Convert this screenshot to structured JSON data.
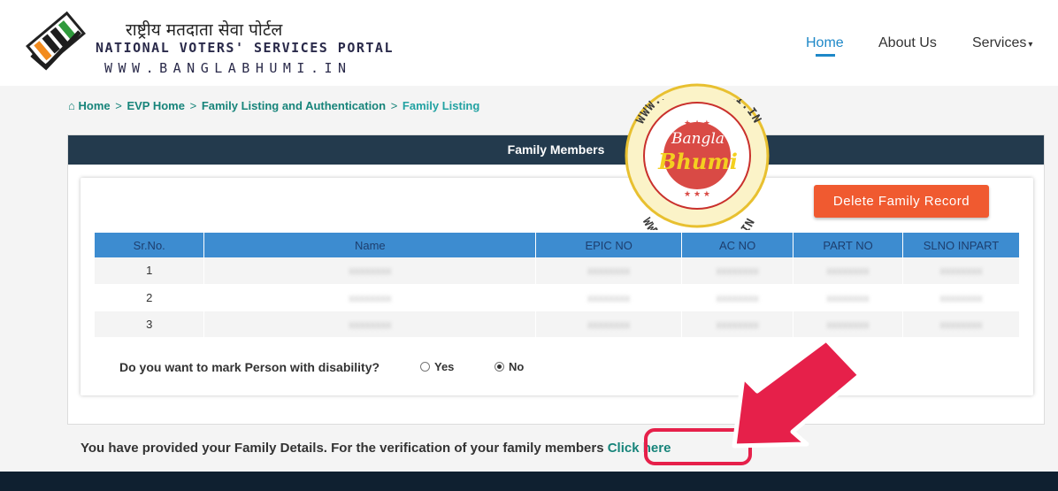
{
  "header": {
    "hindi_title": "राष्ट्रीय मतदाता सेवा पोर्टल",
    "english_title": "NATIONAL VOTERS' SERVICES PORTAL",
    "website": "WWW.BANGLABHUMI.IN",
    "nav": [
      {
        "label": "Home",
        "active": true
      },
      {
        "label": "About Us",
        "active": false
      },
      {
        "label": "Services",
        "active": false
      }
    ]
  },
  "breadcrumb": [
    {
      "label": "Home",
      "icon": "home-icon"
    },
    {
      "label": "EVP Home"
    },
    {
      "label": "Family Listing and Authentication"
    },
    {
      "label": "Family Listing"
    }
  ],
  "panel": {
    "title": "Family Members",
    "delete_button": "Delete Family Record",
    "table": {
      "columns": [
        "Sr.No.",
        "Name",
        "EPIC NO",
        "AC NO",
        "PART NO",
        "SLNO INPART"
      ],
      "rows": [
        {
          "sr": "1",
          "name": "xxxxxxxx",
          "epic": "xxxxxxxx",
          "ac": "xxxxxxxx",
          "part": "xxxxxxxx",
          "slno": "xxxxxxxx"
        },
        {
          "sr": "2",
          "name": "xxxxxxxx",
          "epic": "xxxxxxxx",
          "ac": "xxxxxxxx",
          "part": "xxxxxxxx",
          "slno": "xxxxxxxx"
        },
        {
          "sr": "3",
          "name": "xxxxxxxx",
          "epic": "xxxxxxxx",
          "ac": "xxxxxxxx",
          "part": "xxxxxxxx",
          "slno": "xxxxxxxx"
        }
      ]
    },
    "disability_question": "Do you want to mark Person with disability?",
    "options": [
      {
        "label": "Yes",
        "selected": false
      },
      {
        "label": "No",
        "selected": true
      }
    ]
  },
  "notice": {
    "text": "You have provided your Family Details. For the verification of your family members",
    "link": "Click here"
  },
  "watermark": {
    "ring_text": "WWW.BANGLABHUMI.IN",
    "center_line1": "Bangla",
    "center_line2": "Bhumi"
  },
  "colors": {
    "accent": "#1e88c8",
    "panel_bar": "#233a4d",
    "table_header": "#3d8cd0",
    "delete_button": "#f05a30",
    "link": "#17847a",
    "highlight": "#e6204a"
  }
}
